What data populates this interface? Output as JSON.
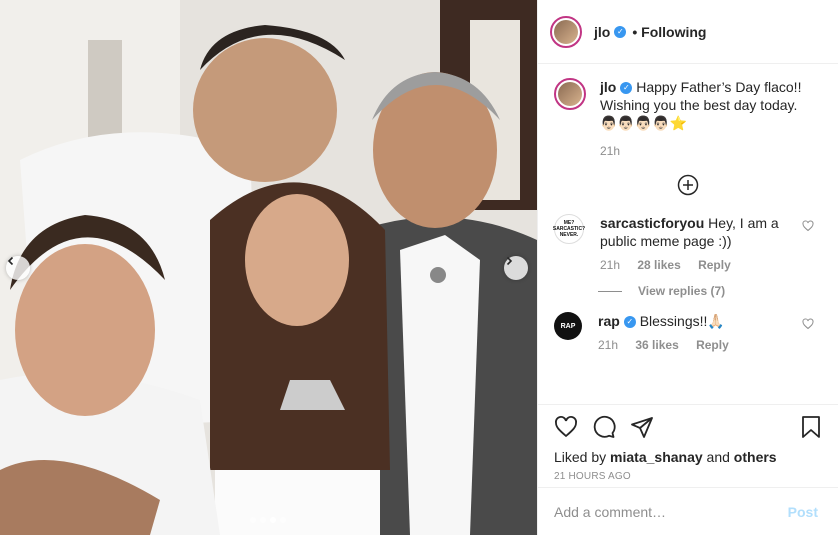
{
  "post": {
    "username": "jlo",
    "follow_status": "Following",
    "photo_alt": "",
    "carousel": {
      "count": 4,
      "active_index": 2
    }
  },
  "caption": {
    "username": "jlo",
    "text": "Happy Father’s Day flaco!! Wishing you the best day today.",
    "emojis": "👨🏻👨🏻👨🏻👨🏻⭐",
    "time": "21h"
  },
  "comments": [
    {
      "username": "sarcasticforyou",
      "avatar_text": "ME? SARCASTIC? NEVER.",
      "text": "Hey, I am a public meme page :))",
      "time": "21h",
      "likes": "28 likes",
      "reply": "Reply",
      "view_replies": "View replies (7)"
    },
    {
      "username": "rap",
      "avatar_text": "RAP",
      "text": "Blessings!!🙏🏻",
      "time": "21h",
      "likes": "36 likes",
      "reply": "Reply"
    }
  ],
  "liked_by": {
    "prefix": "Liked by",
    "user": "miata_shanay",
    "and": "and",
    "others": "others"
  },
  "time_ago": "21 HOURS AGO",
  "add_comment": {
    "placeholder": "Add a comment…",
    "post_label": "Post"
  },
  "colors": {
    "verified": "#3897f0",
    "story_ring": "#c13584",
    "post_disabled": "#b2dffc",
    "muted": "#8e8e8e"
  }
}
